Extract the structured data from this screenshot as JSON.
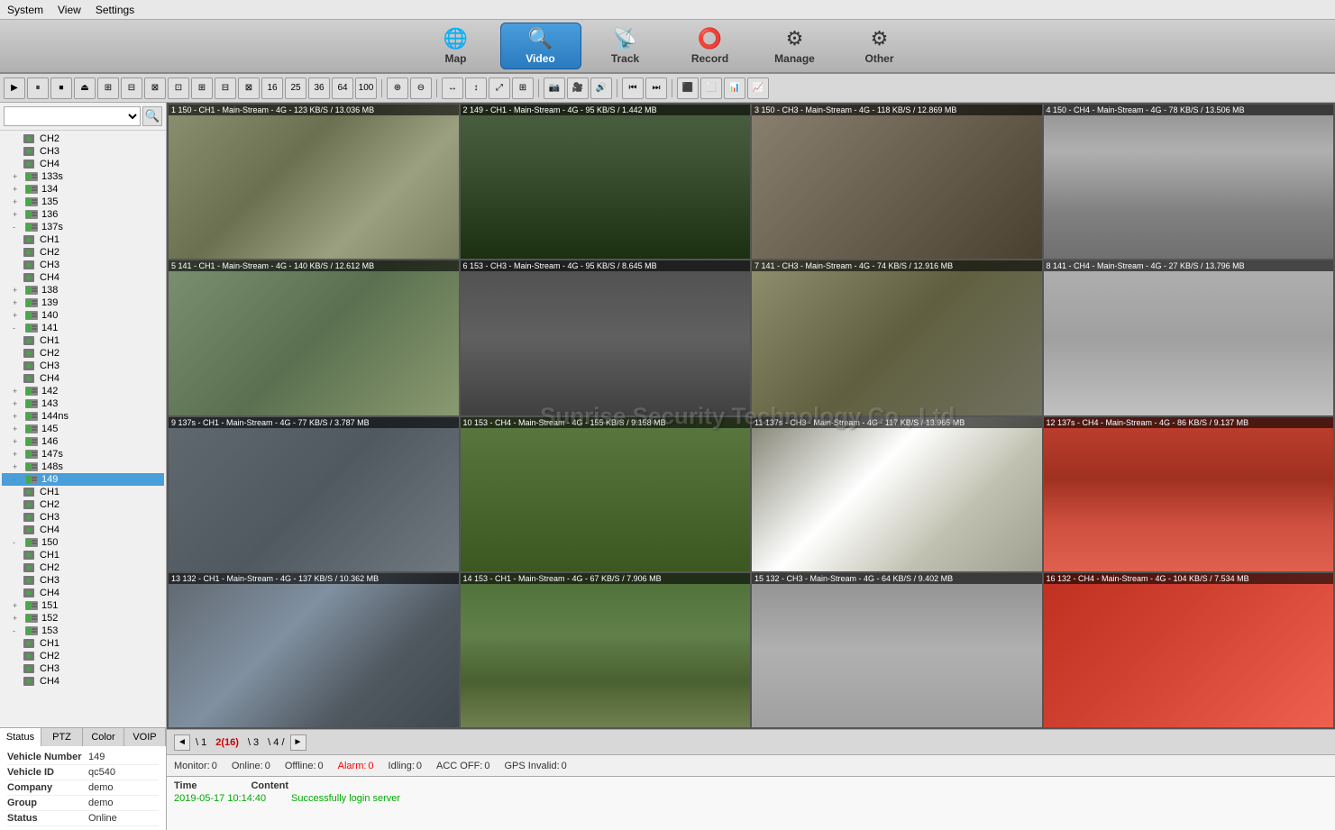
{
  "menu": {
    "items": [
      "System",
      "View",
      "Settings"
    ]
  },
  "nav": {
    "items": [
      {
        "id": "map",
        "label": "Map",
        "icon": "🌐",
        "active": false
      },
      {
        "id": "video",
        "label": "Video",
        "icon": "🔍",
        "active": true
      },
      {
        "id": "track",
        "label": "Track",
        "icon": "📡",
        "active": false
      },
      {
        "id": "record",
        "label": "Record",
        "icon": "⭕",
        "active": false
      },
      {
        "id": "manage",
        "label": "Manage",
        "icon": "⚙",
        "active": false
      },
      {
        "id": "other",
        "label": "Other",
        "icon": "⚙",
        "active": false
      }
    ]
  },
  "sidebar": {
    "tree": [
      {
        "id": "ch2",
        "label": "CH2",
        "indent": 2,
        "type": "channel",
        "expanded": false
      },
      {
        "id": "ch3",
        "label": "CH3",
        "indent": 2,
        "type": "channel",
        "expanded": false
      },
      {
        "id": "ch4",
        "label": "CH4",
        "indent": 2,
        "type": "channel",
        "expanded": false
      },
      {
        "id": "133s",
        "label": "133s",
        "indent": 1,
        "type": "dvr",
        "expanded": false
      },
      {
        "id": "134",
        "label": "134",
        "indent": 1,
        "type": "dvr",
        "expanded": false
      },
      {
        "id": "135",
        "label": "135",
        "indent": 1,
        "type": "dvr",
        "expanded": false
      },
      {
        "id": "136",
        "label": "136",
        "indent": 1,
        "type": "dvr",
        "expanded": false
      },
      {
        "id": "137s",
        "label": "137s",
        "indent": 1,
        "type": "dvr",
        "expanded": true
      },
      {
        "id": "137s-ch1",
        "label": "CH1",
        "indent": 2,
        "type": "channel",
        "expanded": false
      },
      {
        "id": "137s-ch2",
        "label": "CH2",
        "indent": 2,
        "type": "channel",
        "expanded": false
      },
      {
        "id": "137s-ch3",
        "label": "CH3",
        "indent": 2,
        "type": "channel",
        "expanded": false
      },
      {
        "id": "137s-ch4",
        "label": "CH4",
        "indent": 2,
        "type": "channel",
        "expanded": false
      },
      {
        "id": "138",
        "label": "138",
        "indent": 1,
        "type": "dvr",
        "expanded": false
      },
      {
        "id": "139",
        "label": "139",
        "indent": 1,
        "type": "dvr",
        "expanded": false
      },
      {
        "id": "140",
        "label": "140",
        "indent": 1,
        "type": "dvr",
        "expanded": false
      },
      {
        "id": "141",
        "label": "141",
        "indent": 1,
        "type": "dvr",
        "expanded": true
      },
      {
        "id": "141-ch1",
        "label": "CH1",
        "indent": 2,
        "type": "channel",
        "expanded": false
      },
      {
        "id": "141-ch2",
        "label": "CH2",
        "indent": 2,
        "type": "channel",
        "expanded": false
      },
      {
        "id": "141-ch3",
        "label": "CH3",
        "indent": 2,
        "type": "channel",
        "expanded": false
      },
      {
        "id": "141-ch4",
        "label": "CH4",
        "indent": 2,
        "type": "channel",
        "expanded": false
      },
      {
        "id": "142",
        "label": "142",
        "indent": 1,
        "type": "dvr",
        "expanded": false
      },
      {
        "id": "143",
        "label": "143",
        "indent": 1,
        "type": "dvr",
        "expanded": false
      },
      {
        "id": "144ns",
        "label": "144ns",
        "indent": 1,
        "type": "dvr",
        "expanded": false
      },
      {
        "id": "145",
        "label": "145",
        "indent": 1,
        "type": "dvr",
        "expanded": false
      },
      {
        "id": "146",
        "label": "146",
        "indent": 1,
        "type": "dvr",
        "expanded": false
      },
      {
        "id": "147s",
        "label": "147s",
        "indent": 1,
        "type": "dvr",
        "expanded": false
      },
      {
        "id": "148s",
        "label": "148s",
        "indent": 1,
        "type": "dvr",
        "expanded": false
      },
      {
        "id": "149",
        "label": "149",
        "indent": 1,
        "type": "dvr",
        "expanded": true,
        "selected": true
      },
      {
        "id": "149-ch1",
        "label": "CH1",
        "indent": 2,
        "type": "channel",
        "expanded": false
      },
      {
        "id": "149-ch2",
        "label": "CH2",
        "indent": 2,
        "type": "channel",
        "expanded": false
      },
      {
        "id": "149-ch3",
        "label": "CH3",
        "indent": 2,
        "type": "channel",
        "expanded": false
      },
      {
        "id": "149-ch4",
        "label": "CH4",
        "indent": 2,
        "type": "channel",
        "expanded": false
      },
      {
        "id": "150",
        "label": "150",
        "indent": 1,
        "type": "dvr",
        "expanded": true
      },
      {
        "id": "150-ch1",
        "label": "CH1",
        "indent": 2,
        "type": "channel",
        "expanded": false
      },
      {
        "id": "150-ch2",
        "label": "CH2",
        "indent": 2,
        "type": "channel",
        "expanded": false
      },
      {
        "id": "150-ch3",
        "label": "CH3",
        "indent": 2,
        "type": "channel",
        "expanded": false
      },
      {
        "id": "150-ch4",
        "label": "CH4",
        "indent": 2,
        "type": "channel",
        "expanded": false
      },
      {
        "id": "151",
        "label": "151",
        "indent": 1,
        "type": "dvr",
        "expanded": false
      },
      {
        "id": "152",
        "label": "152",
        "indent": 1,
        "type": "dvr",
        "expanded": false
      },
      {
        "id": "153",
        "label": "153",
        "indent": 1,
        "type": "dvr",
        "expanded": true
      },
      {
        "id": "153-ch1",
        "label": "CH1",
        "indent": 2,
        "type": "channel",
        "expanded": false
      },
      {
        "id": "153-ch2",
        "label": "CH2",
        "indent": 2,
        "type": "channel",
        "expanded": false
      },
      {
        "id": "153-ch3",
        "label": "CH3",
        "indent": 2,
        "type": "channel",
        "expanded": false
      },
      {
        "id": "153-ch4",
        "label": "CH4",
        "indent": 2,
        "type": "channel",
        "expanded": false
      }
    ],
    "tabs": [
      "Status",
      "PTZ",
      "Color",
      "VOIP"
    ],
    "active_tab": "Status",
    "info": {
      "vehicle_number_label": "Vehicle Number",
      "vehicle_number_value": "149",
      "vehicle_id_label": "Vehicle ID",
      "vehicle_id_value": "qc540",
      "company_label": "Company",
      "company_value": "demo",
      "group_label": "Group",
      "group_value": "demo",
      "status_label": "Status",
      "status_value": "Online"
    }
  },
  "video_grid": {
    "cells": [
      {
        "num": "1",
        "info": "150 - CH1 - Main-Stream - 4G - 123 KB/S / 13.036 MB",
        "feed": "feed-1"
      },
      {
        "num": "2",
        "info": "149 - CH1 - Main-Stream - 4G - 95 KB/S / 1.442 MB",
        "feed": "feed-2"
      },
      {
        "num": "3",
        "info": "150 - CH3 - Main-Stream - 4G - 118 KB/S / 12.869 MB",
        "feed": "feed-3"
      },
      {
        "num": "4",
        "info": "150 - CH4 - Main-Stream - 4G - 78 KB/S / 13.506 MB",
        "feed": "feed-4"
      },
      {
        "num": "5",
        "info": "141 - CH1 - Main-Stream - 4G - 140 KB/S / 12.612 MB",
        "feed": "feed-5"
      },
      {
        "num": "6",
        "info": "153 - CH3 - Main-Stream - 4G - 95 KB/S / 8.645 MB",
        "feed": "feed-6"
      },
      {
        "num": "7",
        "info": "141 - CH3 - Main-Stream - 4G - 74 KB/S / 12.916 MB",
        "feed": "feed-7"
      },
      {
        "num": "8",
        "info": "141 - CH4 - Main-Stream - 4G - 27 KB/S / 13.796 MB",
        "feed": "feed-8"
      },
      {
        "num": "9",
        "info": "137s - CH1 - Main-Stream - 4G - 77 KB/S / 3.787 MB",
        "feed": "feed-9"
      },
      {
        "num": "10",
        "info": "153 - CH4 - Main-Stream - 4G - 155 KB/S / 9.158 MB",
        "feed": "feed-10"
      },
      {
        "num": "11",
        "info": "137s - CH3 - Main-Stream - 4G - 117 KB/S / 13.965 MB",
        "feed": "feed-11"
      },
      {
        "num": "12",
        "info": "137s - CH4 - Main-Stream - 4G - 86 KB/S / 9.137 MB",
        "feed": "feed-12"
      },
      {
        "num": "13",
        "info": "132 - CH1 - Main-Stream - 4G - 137 KB/S / 10.362 MB",
        "feed": "feed-13"
      },
      {
        "num": "14",
        "info": "153 - CH1 - Main-Stream - 4G - 67 KB/S / 7.906 MB",
        "feed": "feed-14"
      },
      {
        "num": "15",
        "info": "132 - CH3 - Main-Stream - 4G - 64 KB/S / 9.402 MB",
        "feed": "feed-15"
      },
      {
        "num": "16",
        "info": "132 - CH4 - Main-Stream - 4G - 104 KB/S / 7.534 MB",
        "feed": "feed-16"
      }
    ],
    "watermark": "Sunrise Security Technology Co., Ltd."
  },
  "pagination": {
    "prev_label": "◄",
    "next_label": "►",
    "pages": [
      {
        "num": "1",
        "type": "normal"
      },
      {
        "num": "2(16)",
        "type": "current"
      },
      {
        "num": "3",
        "type": "normal"
      },
      {
        "num": "4",
        "type": "normal"
      }
    ]
  },
  "status_bar": {
    "monitor_label": "Monitor:",
    "monitor_value": "0",
    "online_label": "Online:",
    "online_value": "0",
    "offline_label": "Offline:",
    "offline_value": "0",
    "alarm_label": "Alarm:",
    "alarm_value": "0",
    "idling_label": "Idling:",
    "idling_value": "0",
    "acc_label": "ACC OFF:",
    "acc_value": "0",
    "gps_label": "GPS Invalid:",
    "gps_value": "0"
  },
  "log": {
    "time_header": "Time",
    "content_header": "Content",
    "entries": [
      {
        "time": "2019-05-17 10:14:40",
        "content": "Successfully login server"
      }
    ]
  }
}
